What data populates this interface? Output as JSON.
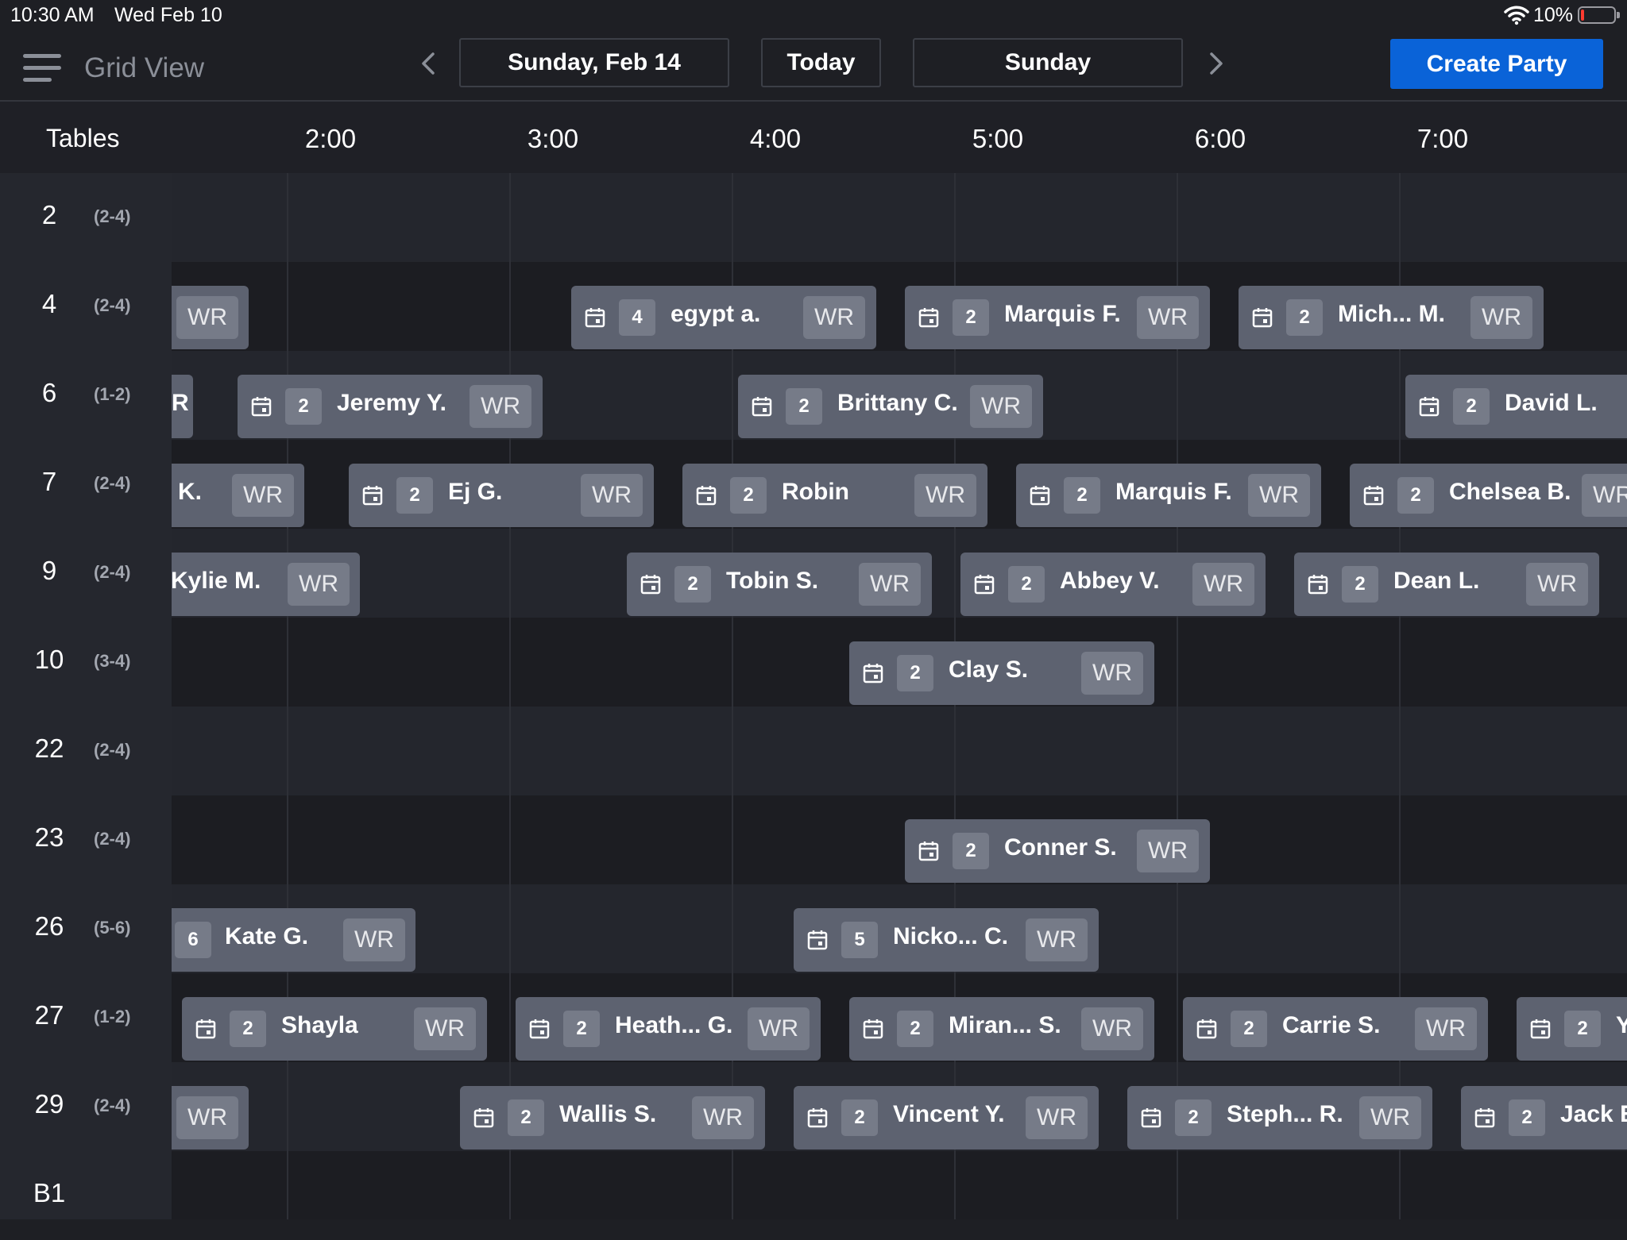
{
  "status_bar": {
    "time": "10:30 AM",
    "date": "Wed Feb 10",
    "battery": "10%"
  },
  "header": {
    "title": "Grid View",
    "date": "Sunday, Feb 14",
    "today_label": "Today",
    "day": "Sunday",
    "create_label": "Create Party"
  },
  "time_header": {
    "tables_label": "Tables",
    "times": [
      "2:00",
      "3:00",
      "4:00",
      "5:00",
      "6:00",
      "7:00"
    ]
  },
  "tables": [
    {
      "num": "2",
      "cap": "(2-4)"
    },
    {
      "num": "4",
      "cap": "(2-4)"
    },
    {
      "num": "6",
      "cap": "(1-2)"
    },
    {
      "num": "7",
      "cap": "(2-4)"
    },
    {
      "num": "9",
      "cap": "(2-4)"
    },
    {
      "num": "10",
      "cap": "(3-4)"
    },
    {
      "num": "22",
      "cap": "(2-4)"
    },
    {
      "num": "23",
      "cap": "(2-4)"
    },
    {
      "num": "26",
      "cap": "(5-6)"
    },
    {
      "num": "27",
      "cap": "(1-2)"
    },
    {
      "num": "29",
      "cap": "(2-4)"
    },
    {
      "num": "B1",
      "cap": ""
    }
  ],
  "reservations": {
    "t4": [
      {
        "party": "",
        "name": "",
        "tag": "WR"
      },
      {
        "party": "4",
        "name": "egypt a.",
        "tag": "WR"
      },
      {
        "party": "2",
        "name": "Marquis F.",
        "tag": "WR"
      },
      {
        "party": "2",
        "name": "Mich...  M.",
        "tag": "WR"
      }
    ],
    "t6": [
      {
        "party": "",
        "name": "R",
        "tag": ""
      },
      {
        "party": "2",
        "name": "Jeremy Y.",
        "tag": "WR"
      },
      {
        "party": "2",
        "name": "Brittany C.",
        "tag": "WR"
      },
      {
        "party": "2",
        "name": "David L.",
        "tag": ""
      }
    ],
    "t7": [
      {
        "party": "",
        "name": "K.",
        "tag": "WR"
      },
      {
        "party": "2",
        "name": "Ej G.",
        "tag": "WR"
      },
      {
        "party": "2",
        "name": "Robin",
        "tag": "WR"
      },
      {
        "party": "2",
        "name": "Marquis F.",
        "tag": "WR"
      },
      {
        "party": "2",
        "name": "Chelsea B.",
        "tag": "WR"
      }
    ],
    "t9": [
      {
        "party": "",
        "name": "Kylie M.",
        "tag": "WR"
      },
      {
        "party": "2",
        "name": "Tobin S.",
        "tag": "WR"
      },
      {
        "party": "2",
        "name": "Abbey V.",
        "tag": "WR"
      },
      {
        "party": "2",
        "name": "Dean L.",
        "tag": "WR"
      }
    ],
    "t10": [
      {
        "party": "2",
        "name": "Clay S.",
        "tag": "WR"
      }
    ],
    "t23": [
      {
        "party": "2",
        "name": "Conner S.",
        "tag": "WR"
      }
    ],
    "t26": [
      {
        "party": "6",
        "name": "Kate G.",
        "tag": "WR"
      },
      {
        "party": "5",
        "name": "Nicko...  C.",
        "tag": "WR"
      }
    ],
    "t27": [
      {
        "party": "2",
        "name": "Shayla",
        "tag": "WR"
      },
      {
        "party": "2",
        "name": "Heath...  G.",
        "tag": "WR"
      },
      {
        "party": "2",
        "name": "Miran...  S.",
        "tag": "WR"
      },
      {
        "party": "2",
        "name": "Carrie S.",
        "tag": "WR"
      },
      {
        "party": "2",
        "name": "Y",
        "tag": ""
      }
    ],
    "t29": [
      {
        "party": "",
        "name": "",
        "tag": "WR"
      },
      {
        "party": "2",
        "name": "Wallis S.",
        "tag": "WR"
      },
      {
        "party": "2",
        "name": "Vincent Y.",
        "tag": "WR"
      },
      {
        "party": "2",
        "name": "Steph...  R.",
        "tag": "WR"
      },
      {
        "party": "2",
        "name": "Jack E",
        "tag": ""
      }
    ]
  }
}
